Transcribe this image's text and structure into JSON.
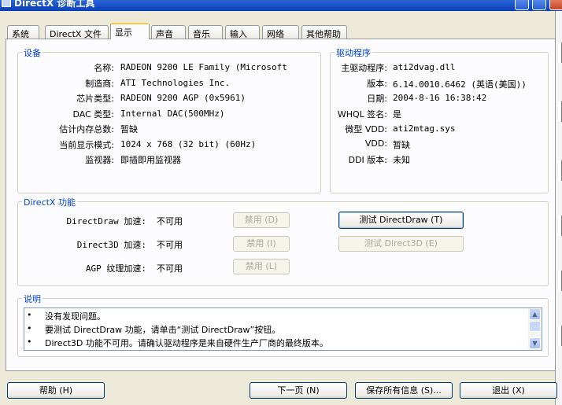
{
  "window": {
    "title": "DirectX 诊断工具"
  },
  "tabs": [
    {
      "label": "系统"
    },
    {
      "label": "DirectX 文件"
    },
    {
      "label": "显示",
      "active": true
    },
    {
      "label": "声音"
    },
    {
      "label": "音乐"
    },
    {
      "label": "输入"
    },
    {
      "label": "网络"
    },
    {
      "label": "其他帮助"
    }
  ],
  "device": {
    "group_label": "设备",
    "rows": [
      {
        "label": "名称:",
        "value": "RADEON 9200 LE Family (Microsoft"
      },
      {
        "label": "制造商:",
        "value": "ATI Technologies Inc."
      },
      {
        "label": "芯片类型:",
        "value": "RADEON 9200 AGP (0x5961)"
      },
      {
        "label": "DAC 类型:",
        "value": "Internal DAC(500MHz)"
      },
      {
        "label": "估计内存总数:",
        "value": "暂缺"
      },
      {
        "label": "当前显示模式:",
        "value": "1024 x 768 (32 bit) (60Hz)"
      },
      {
        "label": "监视器:",
        "value": "即插即用监视器"
      }
    ]
  },
  "drivers": {
    "group_label": "驱动程序",
    "rows": [
      {
        "label": "主驱动程序:",
        "value": "ati2dvag.dll"
      },
      {
        "label": "版本:",
        "value": "6.14.0010.6462 (英语(美国))"
      },
      {
        "label": "日期:",
        "value": "2004-8-16 16:38:42"
      },
      {
        "label": "WHQL 签名:",
        "value": "是"
      },
      {
        "label": "微型 VDD:",
        "value": "ati2mtag.sys"
      },
      {
        "label": "VDD:",
        "value": "暂缺"
      },
      {
        "label": "DDI 版本:",
        "value": "未知"
      }
    ]
  },
  "directx_features": {
    "group_label": "DirectX 功能",
    "rows": [
      {
        "label": "DirectDraw 加速:",
        "value": "不可用",
        "toggle": "禁用 (D)",
        "test": "测试 DirectDraw (T)",
        "test_enabled": true
      },
      {
        "label": "Direct3D 加速:",
        "value": "不可用",
        "toggle": "禁用 (I)",
        "test": "测试 Direct3D (E)",
        "test_enabled": false
      },
      {
        "label": "AGP 纹理加速:",
        "value": "不可用",
        "toggle": "禁用 (L)"
      }
    ]
  },
  "notes": {
    "group_label": "说明",
    "bullet": "•",
    "items": [
      "没有发现问题。",
      "要测试 DirectDraw 功能，请单击“测试 DirectDraw”按钮。",
      "Direct3D 功能不可用。请确认驱动程序是来自硬件生产厂商的最终版本。"
    ]
  },
  "footer": {
    "help": "帮助 (H)",
    "next_page": "下一页 (N)",
    "save_all": "保存所有信息 (S)...",
    "exit": "退出 (X)"
  }
}
